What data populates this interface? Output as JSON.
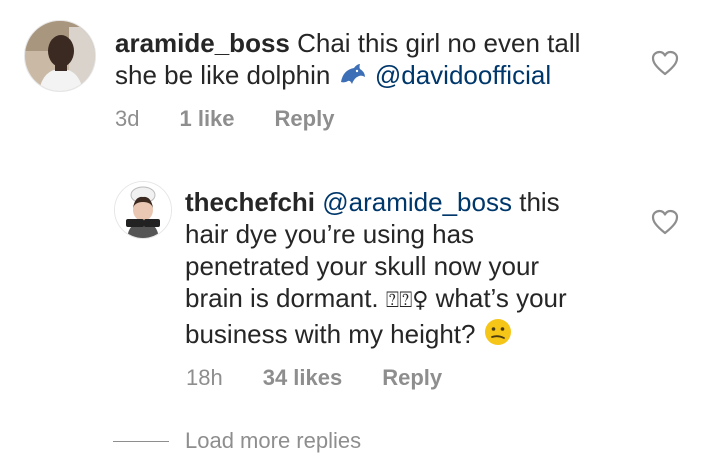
{
  "comments": [
    {
      "username": "aramide_boss",
      "text_line1": "Chai this girl no even tall",
      "text_line2": "she be like dolphin",
      "emoji": "dolphin",
      "mention": "@davidoofficial",
      "time": "3d",
      "likes": "1 like",
      "reply": "Reply",
      "avatar": "user-photo"
    },
    {
      "username": "thechefchi",
      "mention": "@aramide_boss",
      "text_line1_rest": "this",
      "text_line2": "hair dye you’re using has",
      "text_line3": "penetrated your skull now your",
      "text_line4_a": "brain is dormant.",
      "text_line4_glyph": "⍰⍰♀",
      "text_line4_b": "what’s your",
      "text_line5": "business with my height?",
      "emoji": "confused-face",
      "time": "18h",
      "likes": "34 likes",
      "reply": "Reply",
      "avatar": "chef-logo"
    }
  ],
  "load_more": "Load more replies",
  "colors": {
    "text": "#262626",
    "meta": "#8e8e8e",
    "mention": "#00376b",
    "dolphin": "#3c6fb5",
    "emoji_yellow": "#f5c518"
  }
}
